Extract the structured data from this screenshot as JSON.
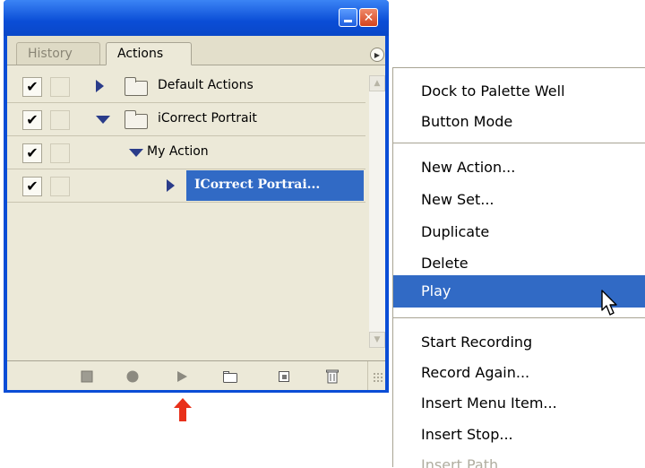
{
  "window": {
    "minimize_label": "",
    "close_label": "✕"
  },
  "tabs": [
    {
      "label": "History",
      "active": false
    },
    {
      "label": "Actions",
      "active": true
    }
  ],
  "actions_list": [
    {
      "checked": true,
      "expanded": false,
      "type": "set",
      "label": "Default Actions",
      "selected": false
    },
    {
      "checked": true,
      "expanded": true,
      "type": "set",
      "label": "iCorrect Portrait",
      "selected": false
    },
    {
      "checked": true,
      "expanded": true,
      "type": "action",
      "label": "My Action",
      "selected": false
    },
    {
      "checked": true,
      "expanded": false,
      "type": "step",
      "label": "ICorrect Portrai...",
      "selected": true
    }
  ],
  "toolbar": {
    "buttons": [
      "stop-icon",
      "record-icon",
      "play-icon",
      "new-set-icon",
      "new-action-icon",
      "trash-icon"
    ]
  },
  "context_menu": {
    "groups": [
      [
        "Dock to Palette Well",
        "Button Mode"
      ],
      [
        "New Action...",
        "New Set...",
        "Duplicate",
        "Delete",
        "Play"
      ],
      [
        "Start Recording",
        "Record Again...",
        "Insert Menu Item...",
        "Insert Stop...",
        "Insert Path"
      ]
    ],
    "highlighted": "Play",
    "disabled": [
      "Insert Path"
    ]
  },
  "colors": {
    "title_bar": "#0a4dd6",
    "selection": "#316ac5",
    "hint_arrow": "#e8301a"
  }
}
